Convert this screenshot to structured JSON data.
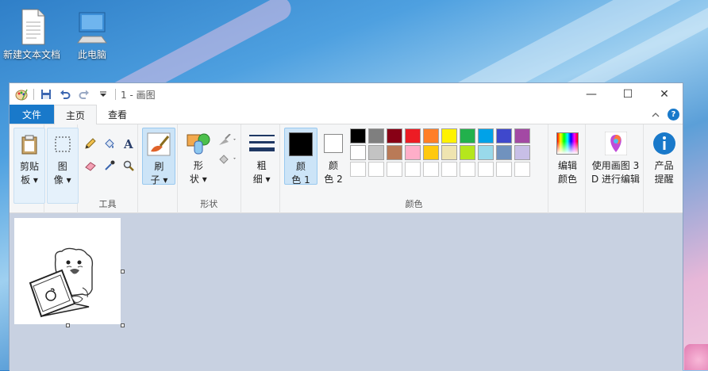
{
  "desktop": {
    "icons": [
      {
        "label": "新建文本文档",
        "icon": "text-file-icon"
      },
      {
        "label": "此电脑",
        "icon": "computer-icon"
      }
    ]
  },
  "window": {
    "title": "1 - 画图",
    "controls": {
      "minimize": "—",
      "maximize": "☐",
      "close": "✕"
    }
  },
  "tabs": [
    {
      "label": "文件"
    },
    {
      "label": "主页"
    },
    {
      "label": "查看"
    }
  ],
  "ribbon": {
    "clipboard": {
      "label": "剪贴板",
      "line1": "剪贴",
      "line2": "板"
    },
    "image": {
      "line1": "图",
      "line2": "像"
    },
    "tools": {
      "group_label": "工具"
    },
    "brushes": {
      "line1": "刷",
      "line2": "子"
    },
    "shapes": {
      "line1": "形",
      "line2": "状",
      "group_label": "形状"
    },
    "size": {
      "line1": "粗",
      "line2": "细"
    },
    "color1": {
      "line1": "颜",
      "line2": "色 1",
      "value": "#000000"
    },
    "color2": {
      "line1": "颜",
      "line2": "色 2",
      "value": "#ffffff"
    },
    "colors_group_label": "颜色",
    "edit_colors": {
      "line1": "编辑",
      "line2": "颜色"
    },
    "paint3d": {
      "line1": "使用画图 3",
      "line2": "D 进行编辑"
    },
    "product_alert": {
      "line1": "产品",
      "line2": "提醒"
    },
    "palette": [
      "#000000",
      "#7f7f7f",
      "#880015",
      "#ed1c24",
      "#ff7f27",
      "#fff200",
      "#22b14c",
      "#00a2e8",
      "#3f48cc",
      "#a349a4",
      "#ffffff",
      "#c3c3c3",
      "#b97a57",
      "#ffaec9",
      "#ffc90e",
      "#efe4b0",
      "#b5e61d",
      "#99d9ea",
      "#7092be",
      "#c8bfe7"
    ]
  }
}
